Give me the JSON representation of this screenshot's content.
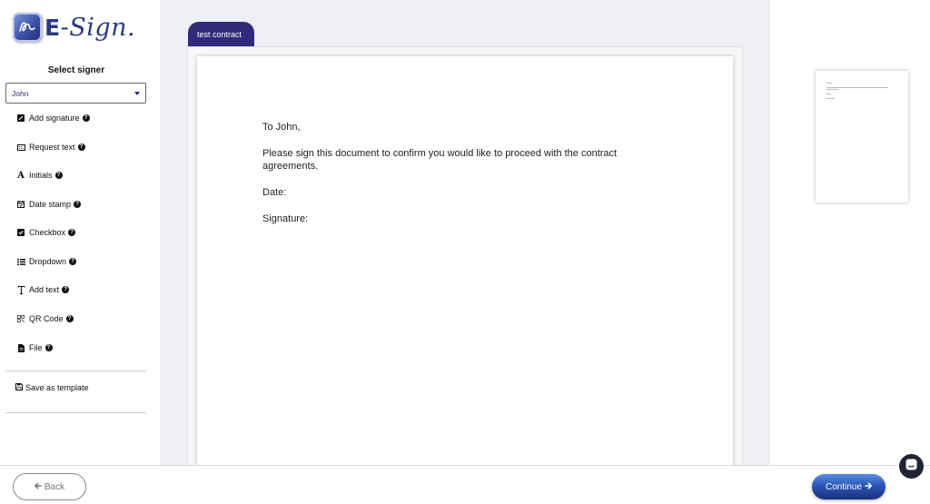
{
  "brand": {
    "logo_text": "E-Sign.",
    "logo_e": "E",
    "logo_rest": "-Sign."
  },
  "signer": {
    "label": "Select signer",
    "selected": "John"
  },
  "tools": [
    {
      "label": "Add signature",
      "icon": "signature-icon"
    },
    {
      "label": "Request text",
      "icon": "keyboard-icon"
    },
    {
      "label": "Initials",
      "icon": "initials-icon"
    },
    {
      "label": "Date stamp",
      "icon": "calendar-icon"
    },
    {
      "label": "Checkbox",
      "icon": "checkbox-icon"
    },
    {
      "label": "Dropdown",
      "icon": "list-icon"
    },
    {
      "label": "Add text",
      "icon": "text-cursor-icon"
    },
    {
      "label": "QR Code",
      "icon": "qrcode-icon"
    },
    {
      "label": "File",
      "icon": "file-icon"
    }
  ],
  "save_template_label": "Save as template",
  "document": {
    "tab_label": "test contract",
    "greeting": "To John,",
    "body": "Please sign this document to confirm you would like to proceed with the contract agreements.",
    "date_label": "Date:",
    "signature_label": "Signature:"
  },
  "footer": {
    "back_label": "Back",
    "continue_label": "Continue"
  },
  "colors": {
    "primary": "#312a78",
    "accent": "#2a56b8",
    "canvas": "#eef0f4"
  }
}
